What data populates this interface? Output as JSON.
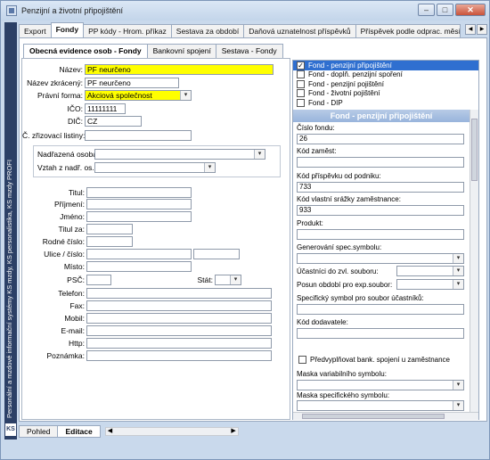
{
  "window": {
    "title": "Penzijní a životní připojištění",
    "buttons": [
      "–",
      "□",
      "✕"
    ]
  },
  "side": {
    "text": "Personální a mzdové informační systémy KS mzdy, KS personalistika, KS mzdy PROFI",
    "logo": "KS"
  },
  "top_tabs": [
    "Export",
    "Fondy",
    "PP kódy - Hrom. příkaz",
    "Sestava za období",
    "Daňová uznatelnost příspěvků",
    "Příspěvek podle odprac. měsíců"
  ],
  "inner_tabs": [
    "Obecná evidence osob - Fondy",
    "Bankovní spojení",
    "Sestava - Fondy"
  ],
  "form": {
    "nazev_label": "Název:",
    "nazev": "PF neurčeno",
    "nazev_zkr_label": "Název zkrácený:",
    "nazev_zkr": "PF neurčeno",
    "pravni_forma_label": "Právní forma:",
    "pravni_forma": "Akciová společnost",
    "ico_label": "IČO:",
    "ico": "11111111",
    "dic_label": "DIČ:",
    "dic": "CZ",
    "zrizovaci_label": "Č. zřizovací listiny:",
    "nadrazena_label": "Nadřazená osoba:",
    "vztah_label": "Vztah z nadř. os.:",
    "titul_label": "Titul:",
    "prijmeni_label": "Příjmení:",
    "jmeno_label": "Jméno:",
    "titul_za_label": "Titul za:",
    "rodne_cislo_label": "Rodné číslo:",
    "ulice_label": "Ulice / číslo:",
    "misto_label": "Místo:",
    "psc_label": "PSČ:",
    "stat_label": "Stát:",
    "telefon_label": "Telefon:",
    "fax_label": "Fax:",
    "mobil_label": "Mobil:",
    "email_label": "E-mail:",
    "http_label": "Http:",
    "poznamka_label": "Poznámka:"
  },
  "funds": [
    {
      "label": "Fond - penzijní připojištění",
      "checked": true,
      "selected": true
    },
    {
      "label": "Fond - doplň. penzijní spoření",
      "checked": false,
      "selected": false
    },
    {
      "label": "Fond - penzijní pojištění",
      "checked": false,
      "selected": false
    },
    {
      "label": "Fond - životní pojištění",
      "checked": false,
      "selected": false
    },
    {
      "label": "Fond - DIP",
      "checked": false,
      "selected": false
    }
  ],
  "detail": {
    "header": "Fond - penzijní připojištění",
    "cislo_fondu_label": "Číslo fondu:",
    "cislo_fondu": "26",
    "kod_zamest_label": "Kód zaměst:",
    "kod_zamest": "",
    "kod_prispevku_label": "Kód příspěvku od podniku:",
    "kod_prispevku": "733",
    "kod_srazky_label": "Kód vlastní srážky zaměstnance:",
    "kod_srazky": "933",
    "produkt_label": "Produkt:",
    "generovani_label": "Generování spec.symbolu:",
    "ucastnici_label": "Účastníci do zvl. souboru:",
    "posun_label": "Posun období pro exp.soubor:",
    "spec_symbol_label": "Specifický symbol pro soubor účastníků:",
    "kod_dodavatele_label": "Kód dodavatele:",
    "predvyplnovat_label": "Předvyplňovat bank. spojení u zaměstnance",
    "maska_var_label": "Maska variabilního symbolu:",
    "maska_spec_label": "Maska specifického symbolu:"
  },
  "bottom_tabs": [
    "Pohled",
    "Editace"
  ]
}
